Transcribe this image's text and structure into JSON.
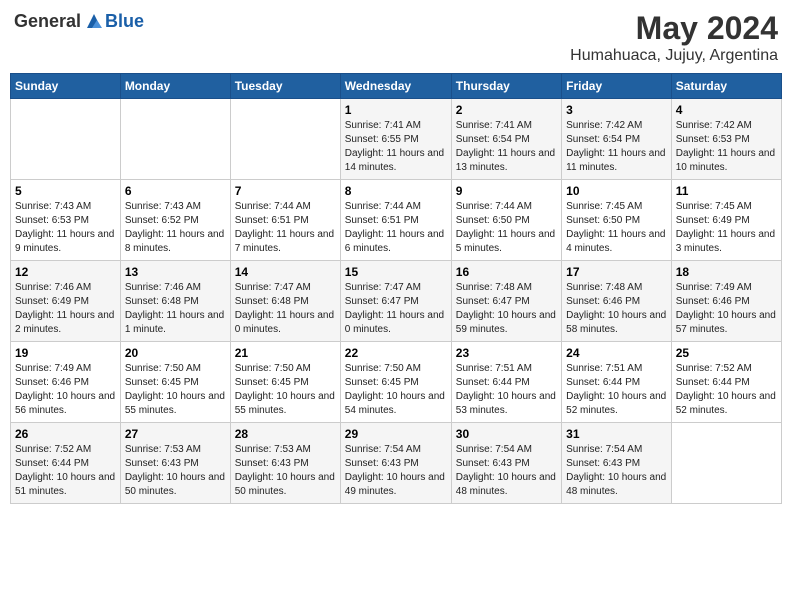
{
  "header": {
    "logo_general": "General",
    "logo_blue": "Blue",
    "month": "May 2024",
    "location": "Humahuaca, Jujuy, Argentina"
  },
  "days_of_week": [
    "Sunday",
    "Monday",
    "Tuesday",
    "Wednesday",
    "Thursday",
    "Friday",
    "Saturday"
  ],
  "weeks": [
    [
      {
        "day": "",
        "info": ""
      },
      {
        "day": "",
        "info": ""
      },
      {
        "day": "",
        "info": ""
      },
      {
        "day": "1",
        "info": "Sunrise: 7:41 AM\nSunset: 6:55 PM\nDaylight: 11 hours and 14 minutes."
      },
      {
        "day": "2",
        "info": "Sunrise: 7:41 AM\nSunset: 6:54 PM\nDaylight: 11 hours and 13 minutes."
      },
      {
        "day": "3",
        "info": "Sunrise: 7:42 AM\nSunset: 6:54 PM\nDaylight: 11 hours and 11 minutes."
      },
      {
        "day": "4",
        "info": "Sunrise: 7:42 AM\nSunset: 6:53 PM\nDaylight: 11 hours and 10 minutes."
      }
    ],
    [
      {
        "day": "5",
        "info": "Sunrise: 7:43 AM\nSunset: 6:53 PM\nDaylight: 11 hours and 9 minutes."
      },
      {
        "day": "6",
        "info": "Sunrise: 7:43 AM\nSunset: 6:52 PM\nDaylight: 11 hours and 8 minutes."
      },
      {
        "day": "7",
        "info": "Sunrise: 7:44 AM\nSunset: 6:51 PM\nDaylight: 11 hours and 7 minutes."
      },
      {
        "day": "8",
        "info": "Sunrise: 7:44 AM\nSunset: 6:51 PM\nDaylight: 11 hours and 6 minutes."
      },
      {
        "day": "9",
        "info": "Sunrise: 7:44 AM\nSunset: 6:50 PM\nDaylight: 11 hours and 5 minutes."
      },
      {
        "day": "10",
        "info": "Sunrise: 7:45 AM\nSunset: 6:50 PM\nDaylight: 11 hours and 4 minutes."
      },
      {
        "day": "11",
        "info": "Sunrise: 7:45 AM\nSunset: 6:49 PM\nDaylight: 11 hours and 3 minutes."
      }
    ],
    [
      {
        "day": "12",
        "info": "Sunrise: 7:46 AM\nSunset: 6:49 PM\nDaylight: 11 hours and 2 minutes."
      },
      {
        "day": "13",
        "info": "Sunrise: 7:46 AM\nSunset: 6:48 PM\nDaylight: 11 hours and 1 minute."
      },
      {
        "day": "14",
        "info": "Sunrise: 7:47 AM\nSunset: 6:48 PM\nDaylight: 11 hours and 0 minutes."
      },
      {
        "day": "15",
        "info": "Sunrise: 7:47 AM\nSunset: 6:47 PM\nDaylight: 11 hours and 0 minutes."
      },
      {
        "day": "16",
        "info": "Sunrise: 7:48 AM\nSunset: 6:47 PM\nDaylight: 10 hours and 59 minutes."
      },
      {
        "day": "17",
        "info": "Sunrise: 7:48 AM\nSunset: 6:46 PM\nDaylight: 10 hours and 58 minutes."
      },
      {
        "day": "18",
        "info": "Sunrise: 7:49 AM\nSunset: 6:46 PM\nDaylight: 10 hours and 57 minutes."
      }
    ],
    [
      {
        "day": "19",
        "info": "Sunrise: 7:49 AM\nSunset: 6:46 PM\nDaylight: 10 hours and 56 minutes."
      },
      {
        "day": "20",
        "info": "Sunrise: 7:50 AM\nSunset: 6:45 PM\nDaylight: 10 hours and 55 minutes."
      },
      {
        "day": "21",
        "info": "Sunrise: 7:50 AM\nSunset: 6:45 PM\nDaylight: 10 hours and 55 minutes."
      },
      {
        "day": "22",
        "info": "Sunrise: 7:50 AM\nSunset: 6:45 PM\nDaylight: 10 hours and 54 minutes."
      },
      {
        "day": "23",
        "info": "Sunrise: 7:51 AM\nSunset: 6:44 PM\nDaylight: 10 hours and 53 minutes."
      },
      {
        "day": "24",
        "info": "Sunrise: 7:51 AM\nSunset: 6:44 PM\nDaylight: 10 hours and 52 minutes."
      },
      {
        "day": "25",
        "info": "Sunrise: 7:52 AM\nSunset: 6:44 PM\nDaylight: 10 hours and 52 minutes."
      }
    ],
    [
      {
        "day": "26",
        "info": "Sunrise: 7:52 AM\nSunset: 6:44 PM\nDaylight: 10 hours and 51 minutes."
      },
      {
        "day": "27",
        "info": "Sunrise: 7:53 AM\nSunset: 6:43 PM\nDaylight: 10 hours and 50 minutes."
      },
      {
        "day": "28",
        "info": "Sunrise: 7:53 AM\nSunset: 6:43 PM\nDaylight: 10 hours and 50 minutes."
      },
      {
        "day": "29",
        "info": "Sunrise: 7:54 AM\nSunset: 6:43 PM\nDaylight: 10 hours and 49 minutes."
      },
      {
        "day": "30",
        "info": "Sunrise: 7:54 AM\nSunset: 6:43 PM\nDaylight: 10 hours and 48 minutes."
      },
      {
        "day": "31",
        "info": "Sunrise: 7:54 AM\nSunset: 6:43 PM\nDaylight: 10 hours and 48 minutes."
      },
      {
        "day": "",
        "info": ""
      }
    ]
  ]
}
